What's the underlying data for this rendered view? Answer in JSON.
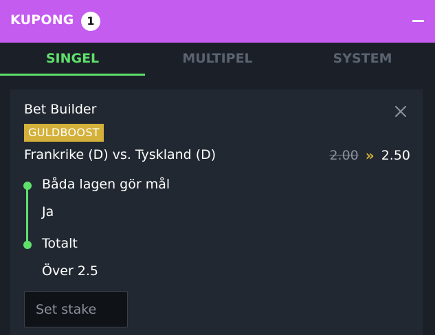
{
  "header": {
    "title": "KUPONG",
    "count": "1",
    "accent_color": "#c45cf0"
  },
  "tabs": [
    {
      "label": "SINGEL",
      "active": true
    },
    {
      "label": "MULTIPEL",
      "active": false
    },
    {
      "label": "SYSTEM",
      "active": false
    }
  ],
  "bet": {
    "title": "Bet Builder",
    "badge": "GULDBOOST",
    "match": "Frankrike (D) vs. Tyskland (D)",
    "old_odds": "2.00",
    "boost_icon": "»",
    "new_odds": "2.50",
    "selections": [
      {
        "market": "Båda lagen gör mål",
        "pick": "Ja"
      },
      {
        "market": "Totalt",
        "pick": "Över 2.5"
      }
    ],
    "stake_placeholder": "Set stake"
  },
  "colors": {
    "active_tab": "#5fe06b",
    "boost": "#d4b13a",
    "background": "#1b2028"
  }
}
